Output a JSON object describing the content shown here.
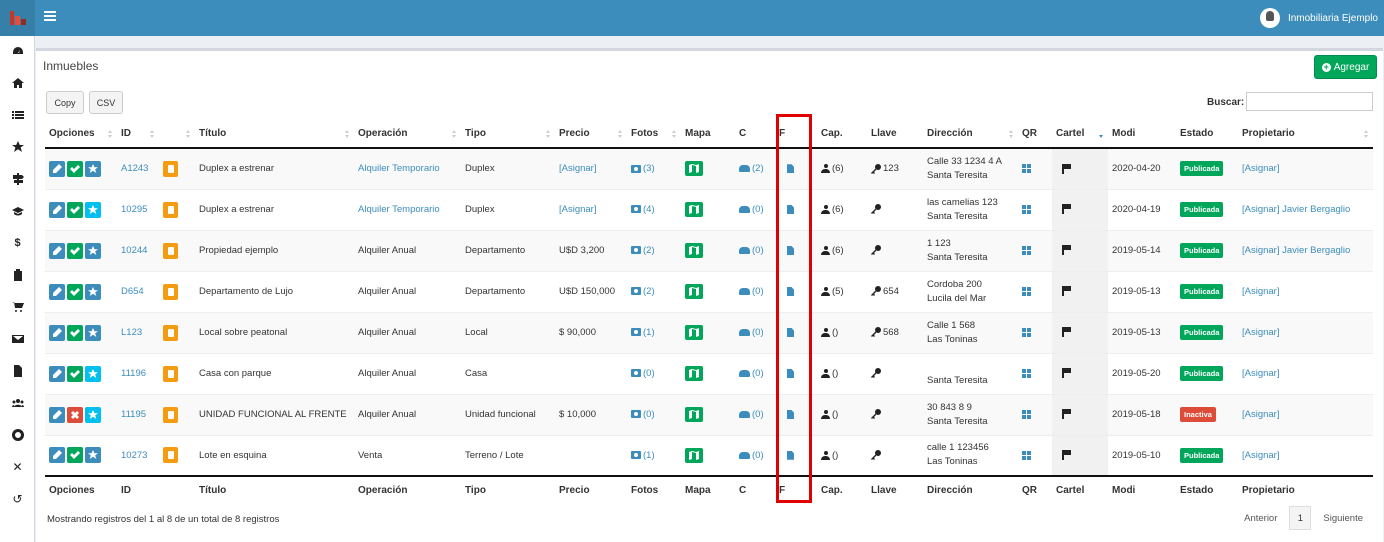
{
  "header": {
    "company": "Inmobiliaria Ejemplo",
    "brand_color": "#3c8dbc"
  },
  "sidebar": {
    "items": [
      {
        "icon": "dashboard-icon"
      },
      {
        "icon": "home-icon"
      },
      {
        "icon": "list-icon"
      },
      {
        "icon": "star-icon"
      },
      {
        "icon": "signpost-icon"
      },
      {
        "icon": "graduation-cap-icon"
      },
      {
        "icon": "dollar-icon"
      },
      {
        "icon": "clipboard-icon"
      },
      {
        "icon": "cart-icon"
      },
      {
        "icon": "envelope-icon"
      },
      {
        "icon": "file-icon"
      },
      {
        "icon": "users-icon"
      },
      {
        "icon": "lifebuoy-icon"
      },
      {
        "icon": "close-icon"
      },
      {
        "icon": "undo-icon"
      }
    ]
  },
  "page": {
    "title": "Inmuebles",
    "add_label": "Agregar",
    "copy_label": "Copy",
    "csv_label": "CSV",
    "search_label": "Buscar:",
    "search_value": ""
  },
  "table": {
    "columns": [
      "Opciones",
      "ID",
      "",
      "Título",
      "Operación",
      "Tipo",
      "Precio",
      "Fotos",
      "Mapa",
      "C",
      "F",
      "Cap.",
      "Llave",
      "Dirección",
      "QR",
      "Cartel",
      "Modi",
      "Estado",
      "Propietario"
    ],
    "footer_columns": [
      "Opciones",
      "ID",
      "",
      "Título",
      "Operación",
      "Tipo",
      "Precio",
      "Fotos",
      "Mapa",
      "C",
      "F",
      "Cap.",
      "Llave",
      "Dirección",
      "QR",
      "Cartel",
      "Modi",
      "Estado",
      "Propietario"
    ],
    "rows": [
      {
        "active": true,
        "star_hl": false,
        "id": "A1243",
        "titulo": "Duplex a estrenar",
        "operacion": "Alquiler Temporario",
        "op_link": true,
        "tipo": "Duplex",
        "precio": "[Asignar]",
        "precio_link": true,
        "fotos": "(3)",
        "c": "(2)",
        "cap": "(6)",
        "llave": "123",
        "dir1": "Calle 33 1234 4 A",
        "dir2": "Santa Teresita",
        "modi": "2020-04-20",
        "estado": "Publicada",
        "prop_link": "[Asignar]",
        "prop_name": ""
      },
      {
        "active": true,
        "star_hl": true,
        "id": "10295",
        "titulo": "Duplex a estrenar",
        "operacion": "Alquiler Temporario",
        "op_link": true,
        "tipo": "Duplex",
        "precio": "[Asignar]",
        "precio_link": true,
        "fotos": "(4)",
        "c": "(0)",
        "cap": "(6)",
        "llave": "",
        "dir1": "las camelias 123",
        "dir2": "Santa Teresita",
        "modi": "2020-04-19",
        "estado": "Publicada",
        "prop_link": "[Asignar]",
        "prop_name": "Javier Bergaglio"
      },
      {
        "active": true,
        "star_hl": false,
        "id": "10244",
        "titulo": "Propiedad ejemplo",
        "operacion": "Alquiler Anual",
        "op_link": false,
        "tipo": "Departamento",
        "precio": "U$D 3,200",
        "precio_link": false,
        "fotos": "(2)",
        "c": "(0)",
        "cap": "(6)",
        "llave": "",
        "dir1": "1 123",
        "dir2": "Santa Teresita",
        "modi": "2019-05-14",
        "estado": "Publicada",
        "prop_link": "[Asignar]",
        "prop_name": "Javier Bergaglio"
      },
      {
        "active": true,
        "star_hl": false,
        "id": "D654",
        "titulo": "Departamento de Lujo",
        "operacion": "Alquiler Anual",
        "op_link": false,
        "tipo": "Departamento",
        "precio": "U$D 150,000",
        "precio_link": false,
        "fotos": "(2)",
        "c": "(0)",
        "cap": "(5)",
        "llave": "654",
        "dir1": "Cordoba 200",
        "dir2": "Lucila del Mar",
        "modi": "2019-05-13",
        "estado": "Publicada",
        "prop_link": "[Asignar]",
        "prop_name": ""
      },
      {
        "active": true,
        "star_hl": false,
        "id": "L123",
        "titulo": "Local sobre peatonal",
        "operacion": "Alquiler Anual",
        "op_link": false,
        "tipo": "Local",
        "precio": "$ 90,000",
        "precio_link": false,
        "fotos": "(1)",
        "c": "(0)",
        "cap": "()",
        "llave": "568",
        "dir1": "Calle 1 568",
        "dir2": "Las Toninas",
        "modi": "2019-05-13",
        "estado": "Publicada",
        "prop_link": "[Asignar]",
        "prop_name": ""
      },
      {
        "active": true,
        "star_hl": true,
        "id": "11196",
        "titulo": "Casa con parque",
        "operacion": "Alquiler Anual",
        "op_link": false,
        "tipo": "Casa",
        "precio": "",
        "precio_link": false,
        "fotos": "(0)",
        "c": "(0)",
        "cap": "()",
        "llave": "",
        "dir1": "",
        "dir2": "Santa Teresita",
        "modi": "2019-05-20",
        "estado": "Publicada",
        "prop_link": "[Asignar]",
        "prop_name": ""
      },
      {
        "active": false,
        "star_hl": true,
        "id": "11195",
        "titulo": "UNIDAD FUNCIONAL AL FRENTE",
        "operacion": "Alquiler Anual",
        "op_link": false,
        "tipo": "Unidad funcional",
        "precio": "$ 10,000",
        "precio_link": false,
        "fotos": "(0)",
        "c": "(0)",
        "cap": "()",
        "llave": "",
        "dir1": "30 843 8 9",
        "dir2": "Santa Teresita",
        "modi": "2019-05-18",
        "estado": "Inactiva",
        "prop_link": "[Asignar]",
        "prop_name": ""
      },
      {
        "active": true,
        "star_hl": false,
        "id": "10273",
        "titulo": "Lote en esquina",
        "operacion": "Venta",
        "op_link": false,
        "tipo": "Terreno / Lote",
        "precio": "",
        "precio_link": false,
        "fotos": "(1)",
        "c": "(0)",
        "cap": "()",
        "llave": "",
        "dir1": "calle 1 123456",
        "dir2": "Las Toninas",
        "modi": "2019-05-10",
        "estado": "Publicada",
        "prop_link": "[Asignar]",
        "prop_name": ""
      }
    ]
  },
  "footer": {
    "info": "Mostrando registros del 1 al 8 de un total de 8 registros",
    "prev": "Anterior",
    "page": "1",
    "next": "Siguiente"
  },
  "highlight": {
    "column": "F",
    "color": "#e00000"
  }
}
